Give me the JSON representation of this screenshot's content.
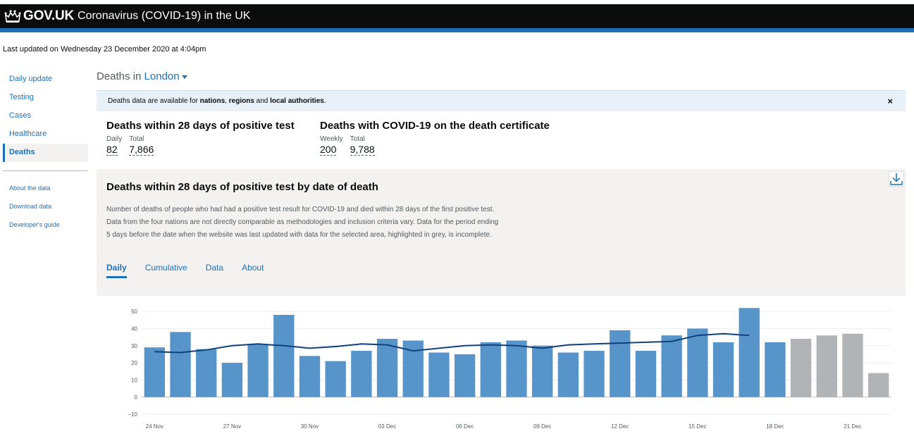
{
  "header": {
    "logo_text": "GOV.UK",
    "service_name": "Coronavirus (COVID-19) in the UK",
    "brand_color": "#0b0c0c",
    "accent_color": "#1d70b8"
  },
  "last_updated": "Last updated on Wednesday 23 December 2020 at 4:04pm",
  "sidebar": {
    "items": [
      {
        "label": "Daily update"
      },
      {
        "label": "Testing"
      },
      {
        "label": "Cases"
      },
      {
        "label": "Healthcare"
      },
      {
        "label": "Deaths"
      }
    ],
    "secondary": [
      {
        "label": "About the data"
      },
      {
        "label": "Download data"
      },
      {
        "label": "Developer's guide"
      }
    ]
  },
  "page": {
    "title_prefix": "Deaths in",
    "location": "London"
  },
  "banner": {
    "text_1": "Deaths data are available for ",
    "link_1": "nations",
    "sep_1": ", ",
    "link_2": "regions",
    "sep_2": " and ",
    "link_3": "local authorities",
    "end": ".",
    "close_label": "×"
  },
  "headlines": {
    "h1": {
      "title": "Deaths within 28 days of positive test",
      "label_1": "Daily",
      "value_1": "82",
      "label_2": "Total",
      "value_2": "7,866"
    },
    "h2": {
      "title": "Deaths with COVID-19 on the death certificate",
      "label_1": "Weekly",
      "value_1": "200",
      "label_2": "Total",
      "value_2": "9,788"
    }
  },
  "card": {
    "title": "Deaths within 28 days of positive test by date of death",
    "description": "Number of deaths of people who had had a positive test result for COVID-19 and died within 28 days of the first positive test. Data from the four nations are not directly comparable as methodologies and inclusion criteria vary. Data for the period ending 5 days before the date when the website was last updated with data for the selected area, highlighted in grey, is incomplete.",
    "tabs": [
      "Daily",
      "Cumulative",
      "Data",
      "About"
    ]
  },
  "chart_data": {
    "type": "bar",
    "categories": [
      "24 Nov",
      "25 Nov",
      "26 Nov",
      "27 Nov",
      "28 Nov",
      "29 Nov",
      "30 Nov",
      "01 Dec",
      "02 Dec",
      "03 Dec",
      "04 Dec",
      "05 Dec",
      "06 Dec",
      "07 Dec",
      "08 Dec",
      "09 Dec",
      "10 Dec",
      "11 Dec",
      "12 Dec",
      "13 Dec",
      "14 Dec",
      "15 Dec",
      "16 Dec",
      "17 Dec",
      "18 Dec",
      "19 Dec",
      "20 Dec",
      "21 Dec",
      "22 Dec"
    ],
    "tick_labels": [
      "24 Nov",
      "27 Nov",
      "30 Nov",
      "03 Dec",
      "06 Dec",
      "09 Dec",
      "12 Dec",
      "15 Dec",
      "18 Dec",
      "21 Dec"
    ],
    "series": [
      {
        "type": "bar",
        "values": [
          29,
          38,
          28,
          20,
          31,
          48,
          24,
          21,
          27,
          34,
          33,
          26,
          25,
          32,
          33,
          30,
          26,
          27,
          39,
          27,
          36,
          40,
          32,
          52,
          32,
          34,
          36,
          37,
          14
        ],
        "incomplete_from_index": 25,
        "color": "#5694ca",
        "incomplete_color": "#b1b4b6"
      },
      {
        "type": "line",
        "values": [
          26.5,
          26,
          27.5,
          30,
          31,
          30,
          28.5,
          29.5,
          31,
          30.5,
          27,
          28.5,
          30,
          30.5,
          30,
          28.5,
          30.5,
          31,
          31.5,
          32,
          32.5,
          36,
          37,
          36,
          null,
          null,
          null,
          null,
          null
        ],
        "color": "#12407a"
      }
    ],
    "y_ticks": [
      -10,
      0,
      10,
      20,
      30,
      40,
      50
    ],
    "ylim": [
      -10,
      55
    ],
    "grid": true
  }
}
